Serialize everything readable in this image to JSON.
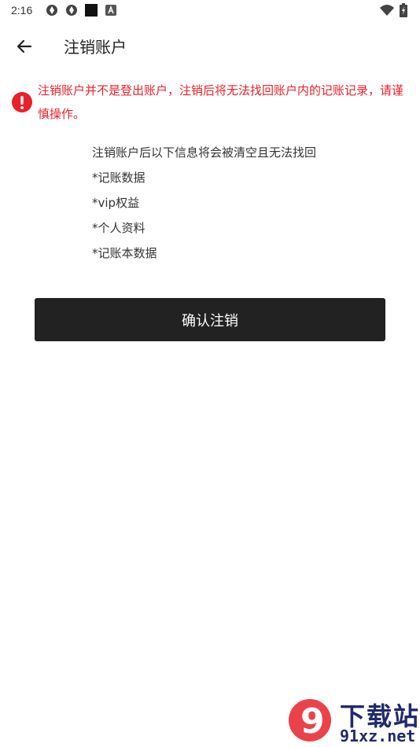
{
  "status_bar": {
    "time": "2:16",
    "left_icons": [
      "aperture-icon",
      "aperture-icon",
      "square-icon",
      "letter-a-icon"
    ],
    "right_icons": [
      "wifi-icon",
      "battery-charging-icon"
    ]
  },
  "app_bar": {
    "back_icon": "arrow-left-icon",
    "title": "注销账户"
  },
  "warning": {
    "icon": "exclamation-circle-icon",
    "text": "注销账户并不是登出账户，注销后将无法找回账户内的记账记录，请谨慎操作。",
    "color": "#e8212a"
  },
  "info": {
    "heading": "注销账户后以下信息将会被清空且无法找回",
    "items": [
      "*记账数据",
      "*vip权益",
      "*个人资料",
      "*记账本数据"
    ]
  },
  "confirm_button": {
    "label": "确认注销",
    "background": "#222222"
  },
  "watermark": {
    "logo_text": "9",
    "title": "下载站",
    "domain": "91xz.net"
  }
}
